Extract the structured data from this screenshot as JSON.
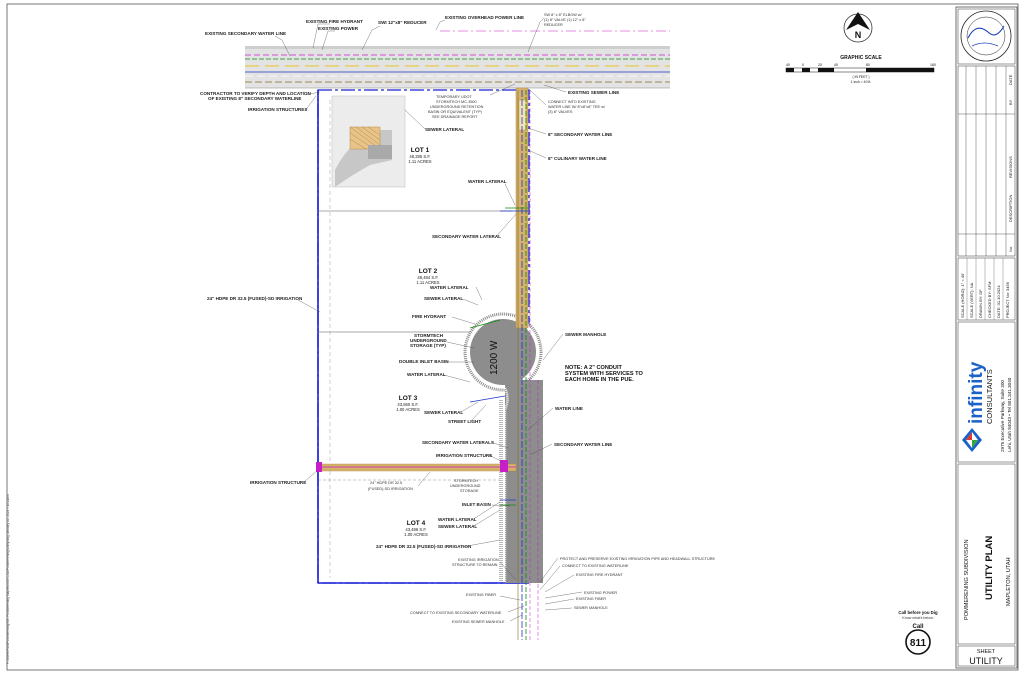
{
  "plan_labels": {
    "existing_fire_hydrant_top": "EXISTING FIRE HYDRANT",
    "existing_power_top": "EXISTING POWER",
    "existing_secondary_water_line": "EXISTING SECONDARY WATER LINE",
    "swi_reducer": "SWI 12\"x8\" REDUCER",
    "existing_overhead_power_line": "EXISTING OVERHEAD POWER LINE",
    "sw_elbow_line1": "SW 8\" x 8\" ELBOW w/",
    "sw_elbow_line2": "(1) 8\" VALVE (1) 12\" x 8\"",
    "sw_elbow_line3": "REDUCER",
    "existing_sewer_line": "EXISTING SEWER LINE",
    "contractor_verify_line1": "CONTRACTOR TO VERIFY DEPTH AND LOCATION",
    "contractor_verify_line2": "OF EXISTING 8\" SECONDARY WATERLINE",
    "irrigation_structures": "IRRIGATION STRUCTURES",
    "temp_udot_line1": "TEMPORARY UDOT",
    "temp_udot_line2": "STORMTECH MC-3500",
    "temp_udot_line3": "UNDERGROUND RETENTION",
    "temp_udot_line4": "BASIN OR EQUIVALENT (TYP)",
    "temp_udot_line5": "SEE DRAINAGE REPORT",
    "connect_existing_line1": "CONNECT INTO EXISTING",
    "connect_existing_line2": "WATER LINE W/ 8\"x8\"x8\" TEE w/",
    "connect_existing_line3": "(3) 8\" VALVES",
    "sewer_lateral_1": "SEWER LATERAL",
    "secondary_water_line_8": "8\" SECONDARY WATER LINE",
    "culinary_water_line_8": "8\" CULINARY WATER LINE",
    "water_lateral_1": "WATER LATERAL",
    "secondary_water_lateral_1": "SECONDARY WATER LATERAL",
    "water_lateral_2": "WATER LATERAL",
    "sewer_lateral_2": "SEWER LATERAL",
    "fire_hydrant": "FIRE HYDRANT",
    "stormtech_storage_line1": "STORMTECH",
    "stormtech_storage_line2": "UNDERGROUND",
    "stormtech_storage_line3": "STORAGE (TYP)",
    "double_inlet_basin": "DOUBLE INLET BASIN",
    "water_lateral_3": "WATER LATERAL",
    "sewer_manhole_1": "SEWER MANHOLE",
    "note_line1": "NOTE:  A 2\" CONDUIT",
    "note_line2": "SYSTEM WITH SERVICES TO",
    "note_line3": "EACH HOME IN THE PUE.",
    "sewer_lateral_3": "SEWER LATERAL",
    "street_light": "STREET LIGHT",
    "water_line": "WATER LINE",
    "secondary_water_laterals": "SECONDARY WATER LATERALS",
    "irrigation_structure_1": "IRRIGATION STRUCTURE",
    "secondary_water_line": "SECONDARY WATER LINE",
    "irrigation_structure_2": "IRRIGATION STRUCTURE",
    "hdpe_24_line1": "24\" HDPE DR 32.5",
    "hdpe_24_line2": "(FUSED)-SD IRRIGATION",
    "stormtech_2_line1": "STORMTECH",
    "stormtech_2_line2": "UNDERGROUND",
    "stormtech_2_line3": "STORAGE",
    "inlet_basin": "INLET BASIN",
    "water_lateral_4": "WATER LATERAL",
    "sewer_lateral_4": "SEWER LATERAL",
    "hdpe_irrigation_left": "24\" HDPE DR 32.5 (FUSED)-SD IRRIGATION",
    "hdpe_irrigation_bottom": "24\" HDPE DR 32.5 (FUSED)-SD IRRIGATION",
    "existing_irrigation_line1": "EXISTING IRRIGATION",
    "existing_irrigation_line2": "STRUCTURE TO REMAIN",
    "protect_preserve": "PROTECT AND PRESERVE EXISTING IRRIGATION PIPE AND HEADWALL STRUCTURE",
    "connect_existing_waterline": "CONNECT TO EXISTING WATERLINE",
    "existing_fire_hydrant_bottom": "EXISTING FIRE HYDRANT",
    "existing_power_bottom": "EXISTING POWER",
    "existing_fiber_right": "EXISTING FIBER",
    "existing_fiber_left": "EXISTING FIBER",
    "sewer_manhole_2": "SEWER MANHOLE",
    "connect_existing_secondary": "CONNECT TO EXISTING SECONDARY WATERLINE",
    "existing_sewer_manhole": "EXISTING SEWER MANHOLE"
  },
  "lots": [
    {
      "title": "LOT 1",
      "area_sf": "48,285 S.F.",
      "acres": "1.11 ACRES"
    },
    {
      "title": "LOT 2",
      "area_sf": "48,484 S.F.",
      "acres": "1.11 ACRES"
    },
    {
      "title": "LOT 3",
      "area_sf": "43,560 S.F.",
      "acres": "1.00 ACRES"
    },
    {
      "title": "LOT 4",
      "area_sf": "43,496 S.F.",
      "acres": "1.00 ACRES"
    }
  ],
  "road_name": "1200 W",
  "north_arrow": "N",
  "graphic_scale": {
    "title": "GRAPHIC SCALE",
    "ticks": [
      "40",
      "0",
      "20",
      "40",
      "80",
      "160"
    ],
    "unit_line1": "( IN FEET )",
    "unit_line2": "1 inch = 40 ft."
  },
  "revisions": {
    "headers": [
      "No.",
      "DESCRIPTION",
      "REVISIONS",
      "BY",
      "DATE"
    ]
  },
  "project_info": {
    "rows": [
      "SCALE (HORIZ):  1\" = 40'",
      "SCALE (VERT):  NA",
      "DRAWN BY:  DF",
      "CHECKED BY:  SFM",
      "DATE:  01.10.2024",
      "PROJECT No:  3456"
    ]
  },
  "company": {
    "name": "infinity",
    "subtitle": "CONSULTANTS",
    "address": "2975 Executive Parkway, Suite 300",
    "city_phone": "Lehi, Utah 84043  •  Tel 801.341.3040"
  },
  "sheet_title": {
    "project": "POMMERENING SUBDIVISION",
    "title": "UTILITY PLAN",
    "location": "MAPLETON, UTAH"
  },
  "call811": {
    "line1": "Call before you Dig",
    "line2": "Know what's below.",
    "call": "Call",
    "number": "811"
  },
  "sheet_label": "SHEET",
  "sheet_number": "UTILITY",
  "file_path": "P:\\Sheet\\Plan\\Pommerening\\WK Pommerening Mapleton\\03 CAD\\Pommerening\\Utility.dwg    January 10, 2024 • 10:11am",
  "colors": {
    "secondary_water": "#0a8a0a",
    "culinary_water": "#1a35c8",
    "sewer": "#c8a04a",
    "irrigation": "#b8b040",
    "property": "#1a22d8",
    "magenta": "#c820c8",
    "concrete": "#8d8d8d",
    "road": "#dcdcdc"
  }
}
